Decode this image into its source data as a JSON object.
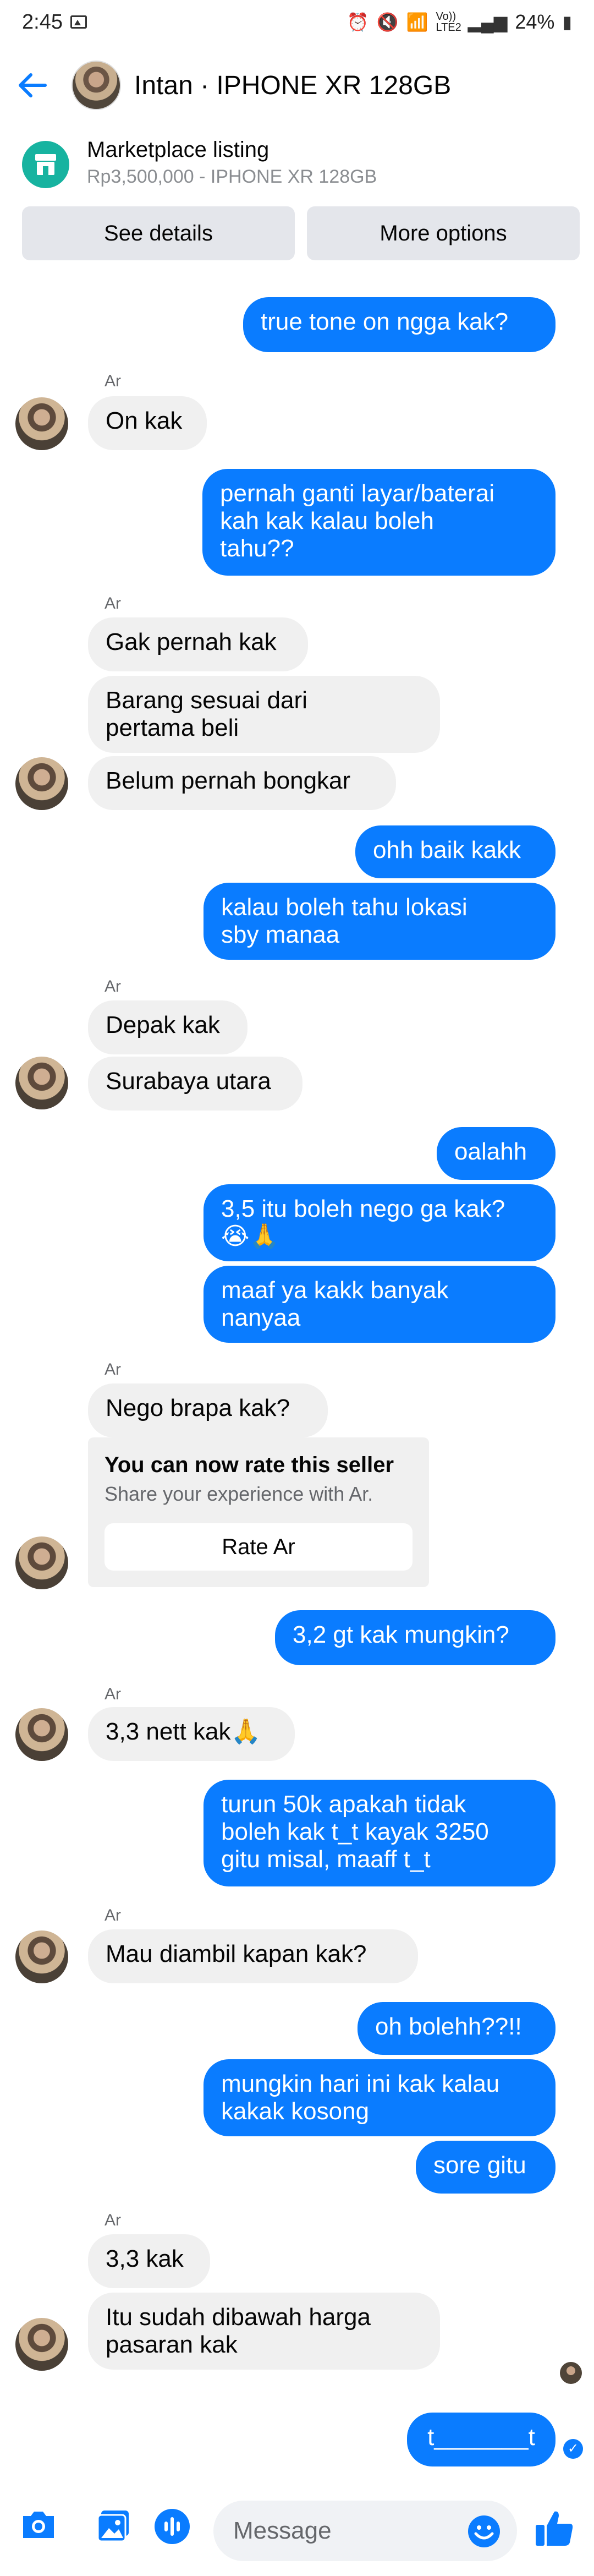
{
  "status_bar": {
    "time": "2:45",
    "network_label": "Vo)) LTE2",
    "battery": "24%"
  },
  "header": {
    "title": "Intan · IPHONE XR 128GB"
  },
  "listing": {
    "title": "Marketplace listing",
    "subtitle": "Rp3,500,000 - IPHONE XR 128GB",
    "see_details": "See details",
    "more_options": "More options"
  },
  "messages": {
    "m1": "true tone on ngga kak?",
    "s1": "Ar",
    "m2": "On kak",
    "m3": "pernah ganti layar/baterai\nkah kak kalau boleh\ntahu??",
    "s2": "Ar",
    "m4": "Gak pernah kak",
    "m5": "Barang sesuai dari\npertama beli",
    "m6": "Belum pernah bongkar",
    "m7": "ohh baik kakk",
    "m8": "kalau boleh tahu lokasi\nsby manaa",
    "s3": "Ar",
    "m9": "Depak kak",
    "m10": "Surabaya utara",
    "m11": "oalahh",
    "m12": "3,5 itu boleh nego ga kak?\n😭🙏",
    "m13": "maaf ya kakk banyak\nnanyaa",
    "s4": "Ar",
    "m14": "Nego brapa kak?",
    "m15": "3,2 gt kak mungkin?",
    "s5": "Ar",
    "m16": "3,3 nett kak🙏",
    "m17": "turun 50k apakah tidak\nboleh kak t_t kayak 3250\ngitu misal, maaff t_t",
    "s6": "Ar",
    "m18": "Mau diambil kapan kak?",
    "m19": "oh bolehh??!!",
    "m20": "mungkin hari ini kak kalau\nkakak kosong",
    "m21": "sore gitu",
    "s7": "Ar",
    "m22": "3,3 kak",
    "m23": "Itu sudah dibawah harga\npasaran kak",
    "m24": "t_______t"
  },
  "rate_card": {
    "title": "You can now rate this seller",
    "subtitle": "Share your experience with Ar.",
    "button": "Rate Ar"
  },
  "composer": {
    "placeholder": "Message"
  },
  "colors": {
    "accent": "#0a7cff",
    "incoming_bubble": "#f0f0f0",
    "listing_icon": "#17b3a0"
  },
  "icons": [
    "back-arrow-icon",
    "camera-icon",
    "gallery-icon",
    "audio-icon",
    "emoji-icon",
    "like-icon",
    "store-icon"
  ]
}
